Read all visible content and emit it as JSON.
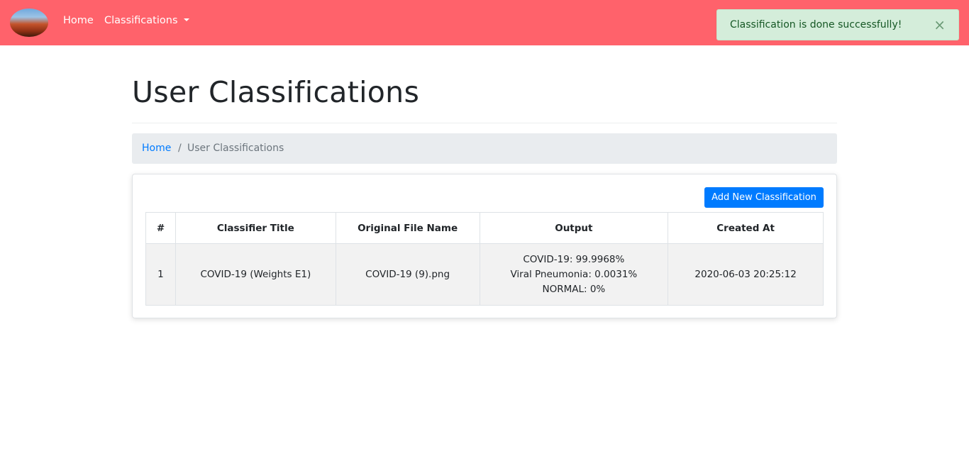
{
  "navbar": {
    "home_label": "Home",
    "classifications_label": "Classifications",
    "bg_color": "#ff626b"
  },
  "alert": {
    "message": "Classification is done successfully!",
    "close_label": "×"
  },
  "page": {
    "title": "User Classifications"
  },
  "breadcrumb": {
    "home": "Home",
    "separator": "/",
    "current": "User Classifications"
  },
  "card": {
    "add_button_label": "Add New Classification"
  },
  "table": {
    "headers": [
      "#",
      "Classifier Title",
      "Original File Name",
      "Output",
      "Created At"
    ],
    "rows": [
      {
        "num": "1",
        "classifier_title": "COVID-19 (Weights E1)",
        "file_name": "COVID-19 (9).png",
        "output": [
          "COVID-19: 99.9968%",
          "Viral Pneumonia: 0.0031%",
          "NORMAL: 0%"
        ],
        "created_at": "2020-06-03 20:25:12"
      }
    ]
  }
}
